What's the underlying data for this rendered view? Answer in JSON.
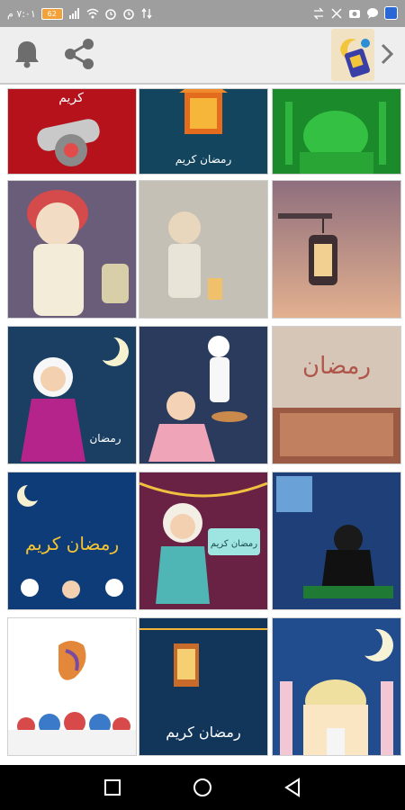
{
  "status_bar": {
    "time": "٧:٠١ م",
    "battery_label": "62",
    "left_icons": [
      "battery-icon",
      "signal-icon",
      "wifi-icon",
      "alarm-icon",
      "data-icon"
    ],
    "right_icons": [
      "arrows-icon",
      "mute-icon",
      "camera-icon",
      "chat-icon",
      "shield-icon"
    ]
  },
  "toolbar": {
    "icons": [
      "bell-icon",
      "share-icon",
      "app-thumbnail",
      "chevron-right-icon"
    ]
  },
  "grid": {
    "tiles": [
      {
        "name": "tile-cannon",
        "caption": "كريم"
      },
      {
        "name": "tile-lantern-blue",
        "caption": "رمضان كريم"
      },
      {
        "name": "tile-green-mosque",
        "caption": ""
      },
      {
        "name": "tile-boy-lantern",
        "caption": ""
      },
      {
        "name": "tile-kids-sketch",
        "caption": ""
      },
      {
        "name": "tile-hanging-lantern",
        "caption": ""
      },
      {
        "name": "tile-girl-moon",
        "caption": "رمضان"
      },
      {
        "name": "tile-kids-night",
        "caption": ""
      },
      {
        "name": "tile-ramadan-text",
        "caption": "رمضان"
      },
      {
        "name": "tile-ramadan-kareem-colorful",
        "caption": "رمضان كريم"
      },
      {
        "name": "tile-girl-sign",
        "caption": "رمضان كريم"
      },
      {
        "name": "tile-girl-praying",
        "caption": ""
      },
      {
        "name": "tile-calligraphy-domes",
        "caption": ""
      },
      {
        "name": "tile-lantern-night",
        "caption": "رمضان كريم"
      },
      {
        "name": "tile-mosque-pattern",
        "caption": ""
      }
    ]
  },
  "nav": {
    "icons": [
      "recents-icon",
      "home-icon",
      "back-icon"
    ]
  }
}
